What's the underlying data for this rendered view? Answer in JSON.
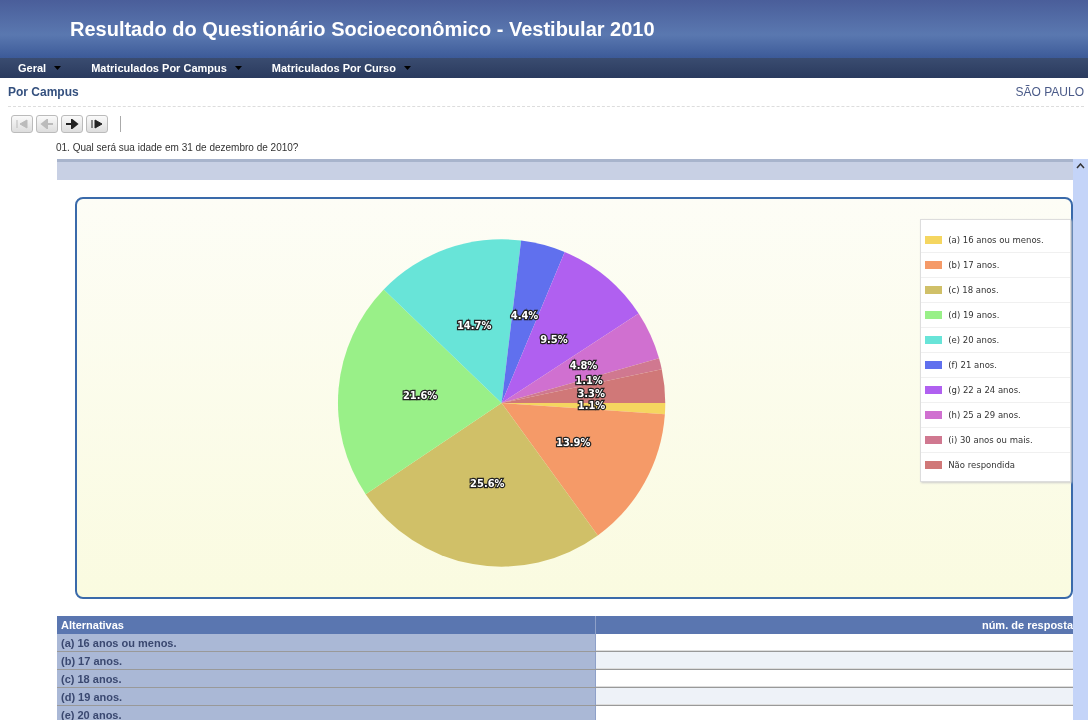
{
  "header": {
    "title": "Resultado do Questionário Socioeconômico - Vestibular 2010"
  },
  "menu": [
    {
      "label": "Geral"
    },
    {
      "label": "Matriculados Por Campus"
    },
    {
      "label": "Matriculados Por Curso"
    }
  ],
  "section": {
    "title": "Por Campus",
    "campus": "SÃO PAULO"
  },
  "nav_buttons": [
    {
      "kind": "first",
      "disabled": true
    },
    {
      "kind": "previous",
      "disabled": true
    },
    {
      "kind": "next",
      "disabled": false
    },
    {
      "kind": "last",
      "disabled": false
    }
  ],
  "question": "01. Qual será sua idade em 31 de dezembro de 2010?",
  "chart": {
    "legend_items": [
      {
        "color": "#f5d660"
      },
      {
        "color": "#f59a68"
      },
      {
        "color": "#d0c068"
      },
      {
        "color": "#99f088"
      },
      {
        "color": "#68e4d8"
      },
      {
        "color": "#6070ee"
      },
      {
        "color": "#b060f0"
      },
      {
        "color": "#d070d0"
      },
      {
        "color": "#d07890"
      },
      {
        "color": "#d07878"
      }
    ],
    "chart_data": {
      "type": "pie",
      "categories": [
        "(a) 16 anos ou menos.",
        "(b) 17 anos.",
        "(c) 18 anos.",
        "(d) 19 anos.",
        "(e) 20 anos.",
        "(f) 21 anos.",
        "(g) 22 a 24 anos.",
        "(h) 25 a 29 anos.",
        "(i) 30 anos ou mais.",
        "Não respondida"
      ],
      "values": [
        1.1,
        13.9,
        25.6,
        21.6,
        14.7,
        4.4,
        9.5,
        4.8,
        1.1,
        3.3
      ],
      "value_labels": [
        "1.1%",
        "13.9%",
        "25.6%",
        "21.6%",
        "14.7%",
        "4.4%",
        "9.5%",
        "4.8%",
        "1.1%",
        "3.3%"
      ]
    }
  },
  "table": {
    "columns": [
      "Alternativas",
      "núm. de resposta"
    ],
    "rows": [
      {
        "alternative": "(a) 16 anos ou menos."
      },
      {
        "alternative": "(b) 17 anos."
      },
      {
        "alternative": "(c) 18 anos."
      },
      {
        "alternative": "(d) 19 anos."
      },
      {
        "alternative": "(e) 20 anos."
      }
    ]
  }
}
